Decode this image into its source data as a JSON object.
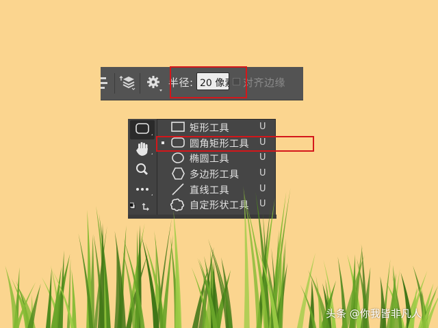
{
  "options_bar": {
    "radius_label": "半径:",
    "radius_value": "20 像素",
    "align_edges_label": "对齐边缘",
    "align_edges_checked": false,
    "icons": [
      "path-alignment-icon",
      "path-arrangement-icon",
      "gear-icon"
    ]
  },
  "toolbar": {
    "tools": [
      {
        "name": "rounded-rectangle-tool",
        "active": true
      },
      {
        "name": "hand-tool",
        "active": false
      },
      {
        "name": "zoom-tool",
        "active": false
      },
      {
        "name": "more-tools",
        "active": false
      },
      {
        "name": "default-colors-swap",
        "active": false
      }
    ]
  },
  "shape_flyout": {
    "items": [
      {
        "label": "矩形工具",
        "shortcut": "U",
        "icon": "rectangle-icon",
        "selected": false
      },
      {
        "label": "圆角矩形工具",
        "shortcut": "U",
        "icon": "rounded-rectangle-icon",
        "selected": true
      },
      {
        "label": "椭圆工具",
        "shortcut": "U",
        "icon": "ellipse-icon",
        "selected": false
      },
      {
        "label": "多边形工具",
        "shortcut": "U",
        "icon": "polygon-icon",
        "selected": false
      },
      {
        "label": "直线工具",
        "shortcut": "U",
        "icon": "line-icon",
        "selected": false
      },
      {
        "label": "自定形状工具",
        "shortcut": "U",
        "icon": "custom-shape-icon",
        "selected": false
      }
    ]
  },
  "colors": {
    "background": "#fbd58f",
    "panel": "#535353",
    "highlight": "#d4161a"
  },
  "watermark": "头条 @你我皆非凡人"
}
